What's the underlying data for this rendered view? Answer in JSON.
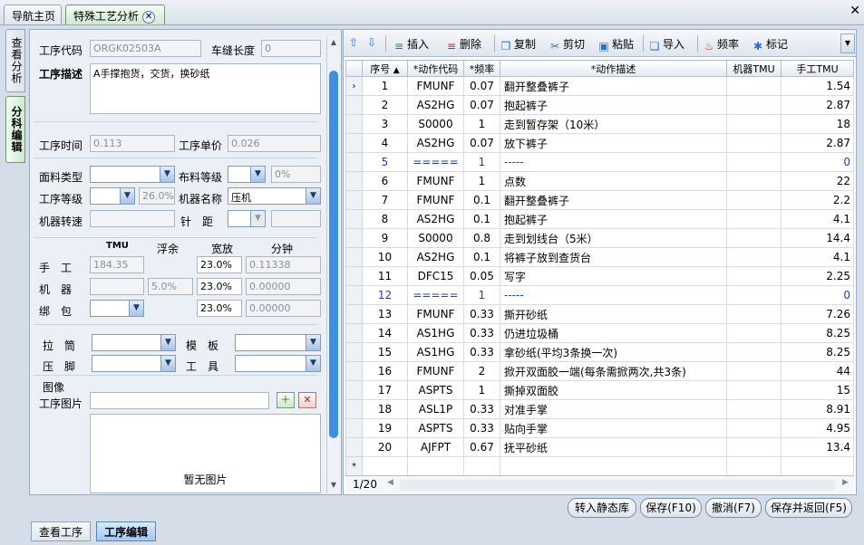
{
  "tabs": {
    "home": "导航主页",
    "current": "特殊工艺分析"
  },
  "side_tabs": {
    "view": "查看分析",
    "edit": "分科编辑"
  },
  "form": {
    "code_label": "工序代码",
    "code_value": "ORGK02503A",
    "seam_label": "车缝长度",
    "seam_value": "0",
    "desc_label": "工序描述",
    "desc_value": "A手撑抱货，交货，换砂纸",
    "time_label": "工序时间",
    "time_value": "0.113",
    "price_label": "工序单价",
    "price_value": "0.026",
    "fabric_type_label": "面料类型",
    "fabric_type_value": "",
    "fabric_grade_label": "布料等级",
    "fabric_grade_value": "",
    "fabric_grade_pct": "0%",
    "process_grade_label": "工序等级",
    "process_grade_value": "",
    "process_grade_pct": "26.0%",
    "machine_name_label": "机器名称",
    "machine_name_value": "压机",
    "machine_speed_label": "机器转速",
    "machine_speed_value": "",
    "needle_label": "针　距",
    "needle_value": "",
    "cols": {
      "tmu": "TMU",
      "slack": "浮余",
      "allow": "宽放",
      "minute": "分钟"
    },
    "rows": {
      "manual": {
        "label": "手　工",
        "tmu": "184.35",
        "slack": "",
        "allow": "23.0%",
        "minute": "0.11338"
      },
      "machine": {
        "label": "机　器",
        "tmu": "",
        "slack": "5.0%",
        "allow": "23.0%",
        "minute": "0.00000"
      },
      "bundle": {
        "label": "绑　包",
        "tmu": "",
        "slack": "",
        "allow": "23.0%",
        "minute": "0.00000"
      }
    },
    "pull_label": "拉　筒",
    "pull_value": "",
    "template_label": "模　板",
    "template_value": "",
    "press_label": "压　脚",
    "press_value": "",
    "tool_label": "工　具",
    "tool_value": "",
    "image_section": "图像",
    "image_label": "工序图片",
    "image_value": "",
    "no_image": "暂无图片"
  },
  "toolbar": {
    "insert": "插入",
    "delete": "删除",
    "copy": "复制",
    "cut": "剪切",
    "paste": "粘贴",
    "import": "导入",
    "freq": "频率",
    "mark": "标记"
  },
  "grid": {
    "headers": [
      "序号",
      "*动作代码",
      "*频率",
      "*动作描述",
      "机器TMU",
      "手工TMU"
    ],
    "rows": [
      {
        "no": "1",
        "code": "FMUNF",
        "freq": "0.07",
        "desc": "翻开整叠裤子",
        "mtmu": "",
        "htmu": "1.54"
      },
      {
        "no": "2",
        "code": "AS2HG",
        "freq": "0.07",
        "desc": "抱起裤子",
        "mtmu": "",
        "htmu": "2.87"
      },
      {
        "no": "3",
        "code": "S0000",
        "freq": "1",
        "desc": "走到暂存架（10米）",
        "mtmu": "",
        "htmu": "18"
      },
      {
        "no": "4",
        "code": "AS2HG",
        "freq": "0.07",
        "desc": "放下裤子",
        "mtmu": "",
        "htmu": "2.87"
      },
      {
        "no": "5",
        "code": "=====",
        "freq": "1",
        "desc": "-----",
        "mtmu": "",
        "htmu": "0",
        "blue": true
      },
      {
        "no": "6",
        "code": "FMUNF",
        "freq": "1",
        "desc": "点数",
        "mtmu": "",
        "htmu": "22"
      },
      {
        "no": "7",
        "code": "FMUNF",
        "freq": "0.1",
        "desc": "翻开整叠裤子",
        "mtmu": "",
        "htmu": "2.2"
      },
      {
        "no": "8",
        "code": "AS2HG",
        "freq": "0.1",
        "desc": "抱起裤子",
        "mtmu": "",
        "htmu": "4.1"
      },
      {
        "no": "9",
        "code": "S0000",
        "freq": "0.8",
        "desc": "走到划线台（5米）",
        "mtmu": "",
        "htmu": "14.4"
      },
      {
        "no": "10",
        "code": "AS2HG",
        "freq": "0.1",
        "desc": "将裤子放到查货台",
        "mtmu": "",
        "htmu": "4.1"
      },
      {
        "no": "11",
        "code": "DFC15",
        "freq": "0.05",
        "desc": "写字",
        "mtmu": "",
        "htmu": "2.25"
      },
      {
        "no": "12",
        "code": "=====",
        "freq": "1",
        "desc": "-----",
        "mtmu": "",
        "htmu": "0",
        "blue": true
      },
      {
        "no": "13",
        "code": "FMUNF",
        "freq": "0.33",
        "desc": "撕开砂纸",
        "mtmu": "",
        "htmu": "7.26"
      },
      {
        "no": "14",
        "code": "AS1HG",
        "freq": "0.33",
        "desc": "仍进垃圾桶",
        "mtmu": "",
        "htmu": "8.25"
      },
      {
        "no": "15",
        "code": "AS1HG",
        "freq": "0.33",
        "desc": "拿砂纸(平均3条换一次)",
        "mtmu": "",
        "htmu": "8.25"
      },
      {
        "no": "16",
        "code": "FMUNF",
        "freq": "2",
        "desc": "掀开双面胶一端(每条需掀两次,共3条)",
        "mtmu": "",
        "htmu": "44"
      },
      {
        "no": "17",
        "code": "ASPTS",
        "freq": "1",
        "desc": "撕掉双面胶",
        "mtmu": "",
        "htmu": "15"
      },
      {
        "no": "18",
        "code": "ASL1P",
        "freq": "0.33",
        "desc": "对准手掌",
        "mtmu": "",
        "htmu": "8.91"
      },
      {
        "no": "19",
        "code": "ASPTS",
        "freq": "0.33",
        "desc": "贴向手掌",
        "mtmu": "",
        "htmu": "4.95"
      },
      {
        "no": "20",
        "code": "AJFPT",
        "freq": "0.67",
        "desc": "抚平砂纸",
        "mtmu": "",
        "htmu": "13.4"
      }
    ],
    "page": "1/20"
  },
  "buttons": {
    "to_static": "转入静态库",
    "save": "保存(F10)",
    "cancel": "撤消(F7)",
    "save_return": "保存并返回(F5)"
  },
  "bottom_tabs": {
    "view": "查看工序",
    "edit": "工序编辑"
  }
}
